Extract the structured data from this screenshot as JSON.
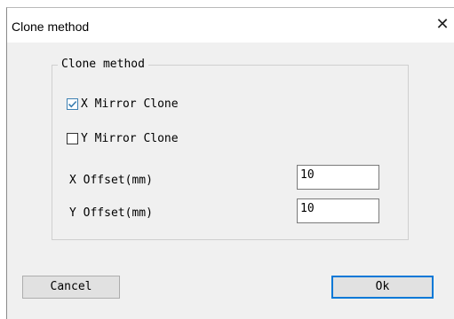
{
  "window": {
    "title": "Clone method",
    "close_glyph": "✕"
  },
  "group": {
    "legend": "Clone method"
  },
  "options": [
    {
      "label": "X Mirror Clone",
      "checked": true
    },
    {
      "label": "Y Mirror Clone",
      "checked": false
    }
  ],
  "fields": [
    {
      "label": "X Offset(mm)",
      "value": "10"
    },
    {
      "label": "Y Offset(mm)",
      "value": "10"
    }
  ],
  "buttons": {
    "cancel": "Cancel",
    "ok": "Ok"
  },
  "colors": {
    "accent": "#0078d7",
    "check": "#3c7fb1"
  }
}
